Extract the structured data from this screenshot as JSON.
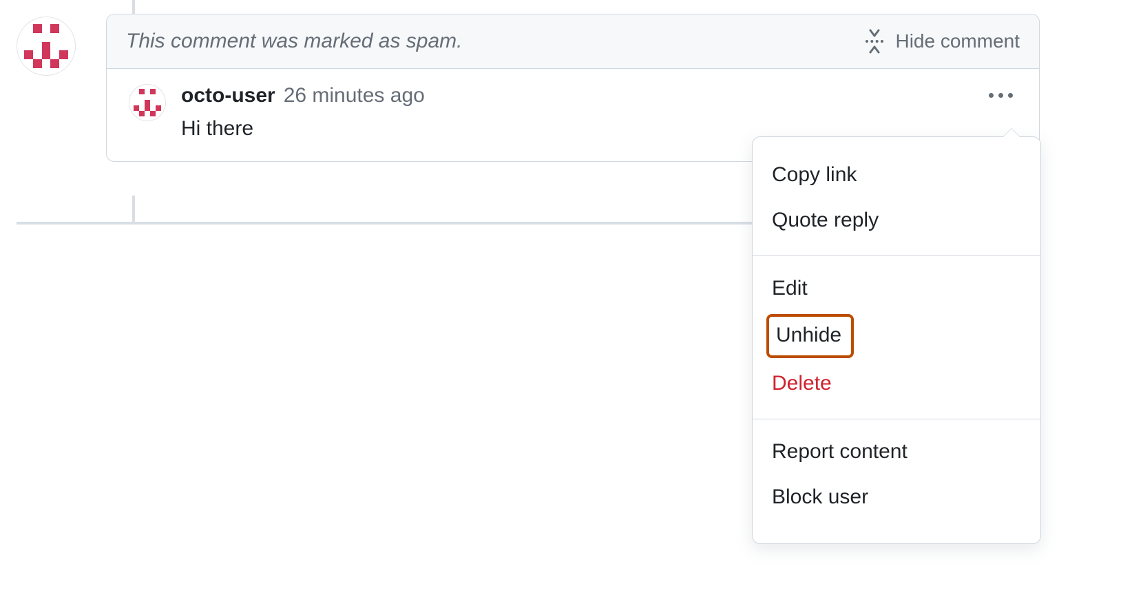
{
  "colors": {
    "avatar_pink": "#d1365b",
    "highlight_border": "#bc4c00",
    "danger": "#cf222e"
  },
  "header": {
    "spam_notice": "This comment was marked as spam.",
    "hide_comment_label": "Hide comment"
  },
  "comment": {
    "username": "octo-user",
    "timestamp": "26 minutes ago",
    "body": "Hi there"
  },
  "menu": {
    "copy_link": "Copy link",
    "quote_reply": "Quote reply",
    "edit": "Edit",
    "unhide": "Unhide",
    "delete": "Delete",
    "report_content": "Report content",
    "block_user": "Block user"
  },
  "icons": {
    "fold": "fold-icon",
    "kebab": "kebab-horizontal-icon"
  }
}
